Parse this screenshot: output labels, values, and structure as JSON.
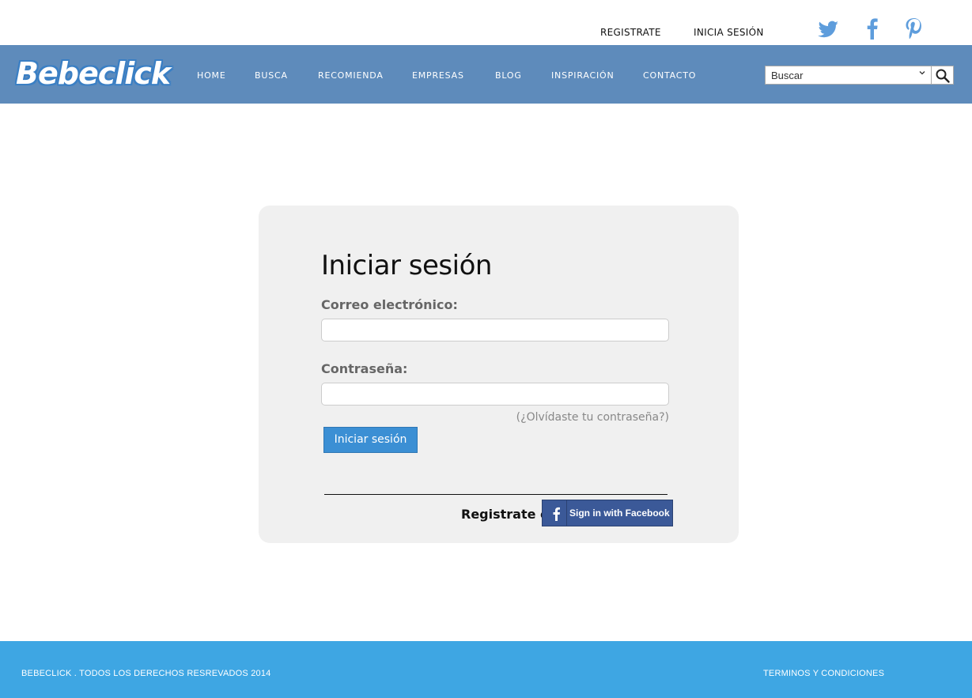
{
  "top": {
    "register_link": "REGISTRATE",
    "login_link": "INICIA SESIÓN",
    "social": [
      "twitter-icon",
      "facebook-icon",
      "pinterest-icon"
    ],
    "social_color": "#5e9ddc"
  },
  "nav": {
    "logo_text": "Bebeclick",
    "items": [
      "HOME",
      "BUSCA",
      "RECOMIENDA",
      "EMPRESAS",
      "BLOG",
      "INSPIRACIÓN",
      "CONTACTO"
    ],
    "background": "#5e8bbb"
  },
  "search": {
    "selected": "Buscar",
    "button_icon": "search-icon"
  },
  "login": {
    "title": "Iniciar sesión",
    "email_label": "Correo electrónico:",
    "email_value": "",
    "password_label": "Contraseña:",
    "password_value": "",
    "forgot_link": "(¿Olvídaste tu contraseña?)",
    "submit_label": "Iniciar sesión",
    "register_text": "Registrate o",
    "facebook_button": "Sign in with Facebook",
    "accent": "#3b8fd4",
    "facebook_color": "#3b5998"
  },
  "footer": {
    "copyright": "BEBECLICK . TODOS LOS DERECHOS RESREVADOS 2014",
    "terms": "TERMINOS Y CONDICIONES",
    "background": "#3ea6e3"
  }
}
